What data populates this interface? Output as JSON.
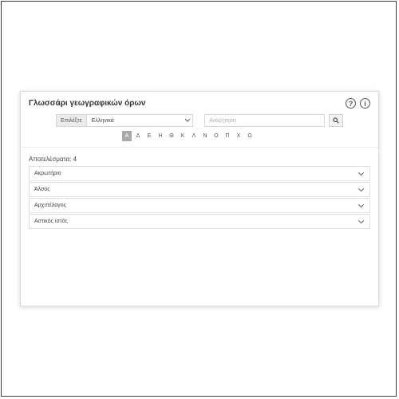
{
  "glossary": {
    "title": "Γλωσσάρι γεωγραφικών όρων",
    "help_icon": "?",
    "info_icon": "i",
    "language": {
      "prefix": "Επιλέξτε",
      "selected": "Ελληνικά"
    },
    "search": {
      "placeholder": "Αναζήτηση",
      "icon": "search-icon"
    },
    "letters": [
      "Α",
      "Δ",
      "Ε",
      "Η",
      "Θ",
      "Κ",
      "Λ",
      "Ν",
      "Ο",
      "Π",
      "Χ",
      "Ω"
    ],
    "active_letter": "Α",
    "results_label": "Αποτελέσματα: 4",
    "results": [
      "Ακρωτήριο",
      "Άλσος",
      "Αρχιπέλαγος",
      "Αστικός ιστός"
    ]
  }
}
